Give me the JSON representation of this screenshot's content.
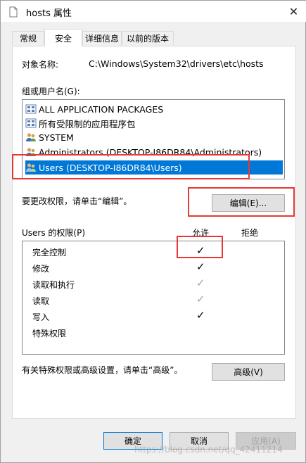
{
  "window": {
    "title": "hosts 属性",
    "close_glyph": "✕"
  },
  "tabs": [
    {
      "label": "常规"
    },
    {
      "label": "安全"
    },
    {
      "label": "详细信息"
    },
    {
      "label": "以前的版本"
    }
  ],
  "object": {
    "label": "对象名称:",
    "value": "C:\\Windows\\System32\\drivers\\etc\\hosts"
  },
  "groups": {
    "label": "组或用户名(G):",
    "items": [
      {
        "label": "ALL APPLICATION PACKAGES",
        "icon": "app-packages-icon"
      },
      {
        "label": "所有受限制的应用程序包",
        "icon": "app-packages-icon"
      },
      {
        "label": "SYSTEM",
        "icon": "users-icon"
      },
      {
        "label": "Administrators (DESKTOP-I86DR84\\Administrators)",
        "icon": "users-icon"
      },
      {
        "label": "Users (DESKTOP-I86DR84\\Users)",
        "icon": "users-icon",
        "selected": true
      }
    ]
  },
  "edit": {
    "hint": "要更改权限，请单击“编辑”。",
    "button": "编辑(E)..."
  },
  "permissions": {
    "label": "Users 的权限(P)",
    "allow_header": "允许",
    "deny_header": "拒绝",
    "rows": [
      {
        "name": "完全控制",
        "allow": "✓"
      },
      {
        "name": "修改",
        "allow": "✓"
      },
      {
        "name": "读取和执行",
        "allow": "✓"
      },
      {
        "name": "读取",
        "allow": "✓"
      },
      {
        "name": "写入",
        "allow": "✓"
      },
      {
        "name": "特殊权限",
        "allow": ""
      }
    ]
  },
  "advanced": {
    "hint": "有关特殊权限或高级设置，请单击“高级”。",
    "button": "高级(V)"
  },
  "footer": {
    "ok": "确定",
    "cancel": "取消",
    "apply": "应用(A)"
  },
  "watermark": "https://blog.csdn.net/qq_42411214",
  "colors": {
    "selection": "#0078d7",
    "highlight_box": "#e53935",
    "check_active": "#000000",
    "check_inherited": "#a6a6a6"
  }
}
